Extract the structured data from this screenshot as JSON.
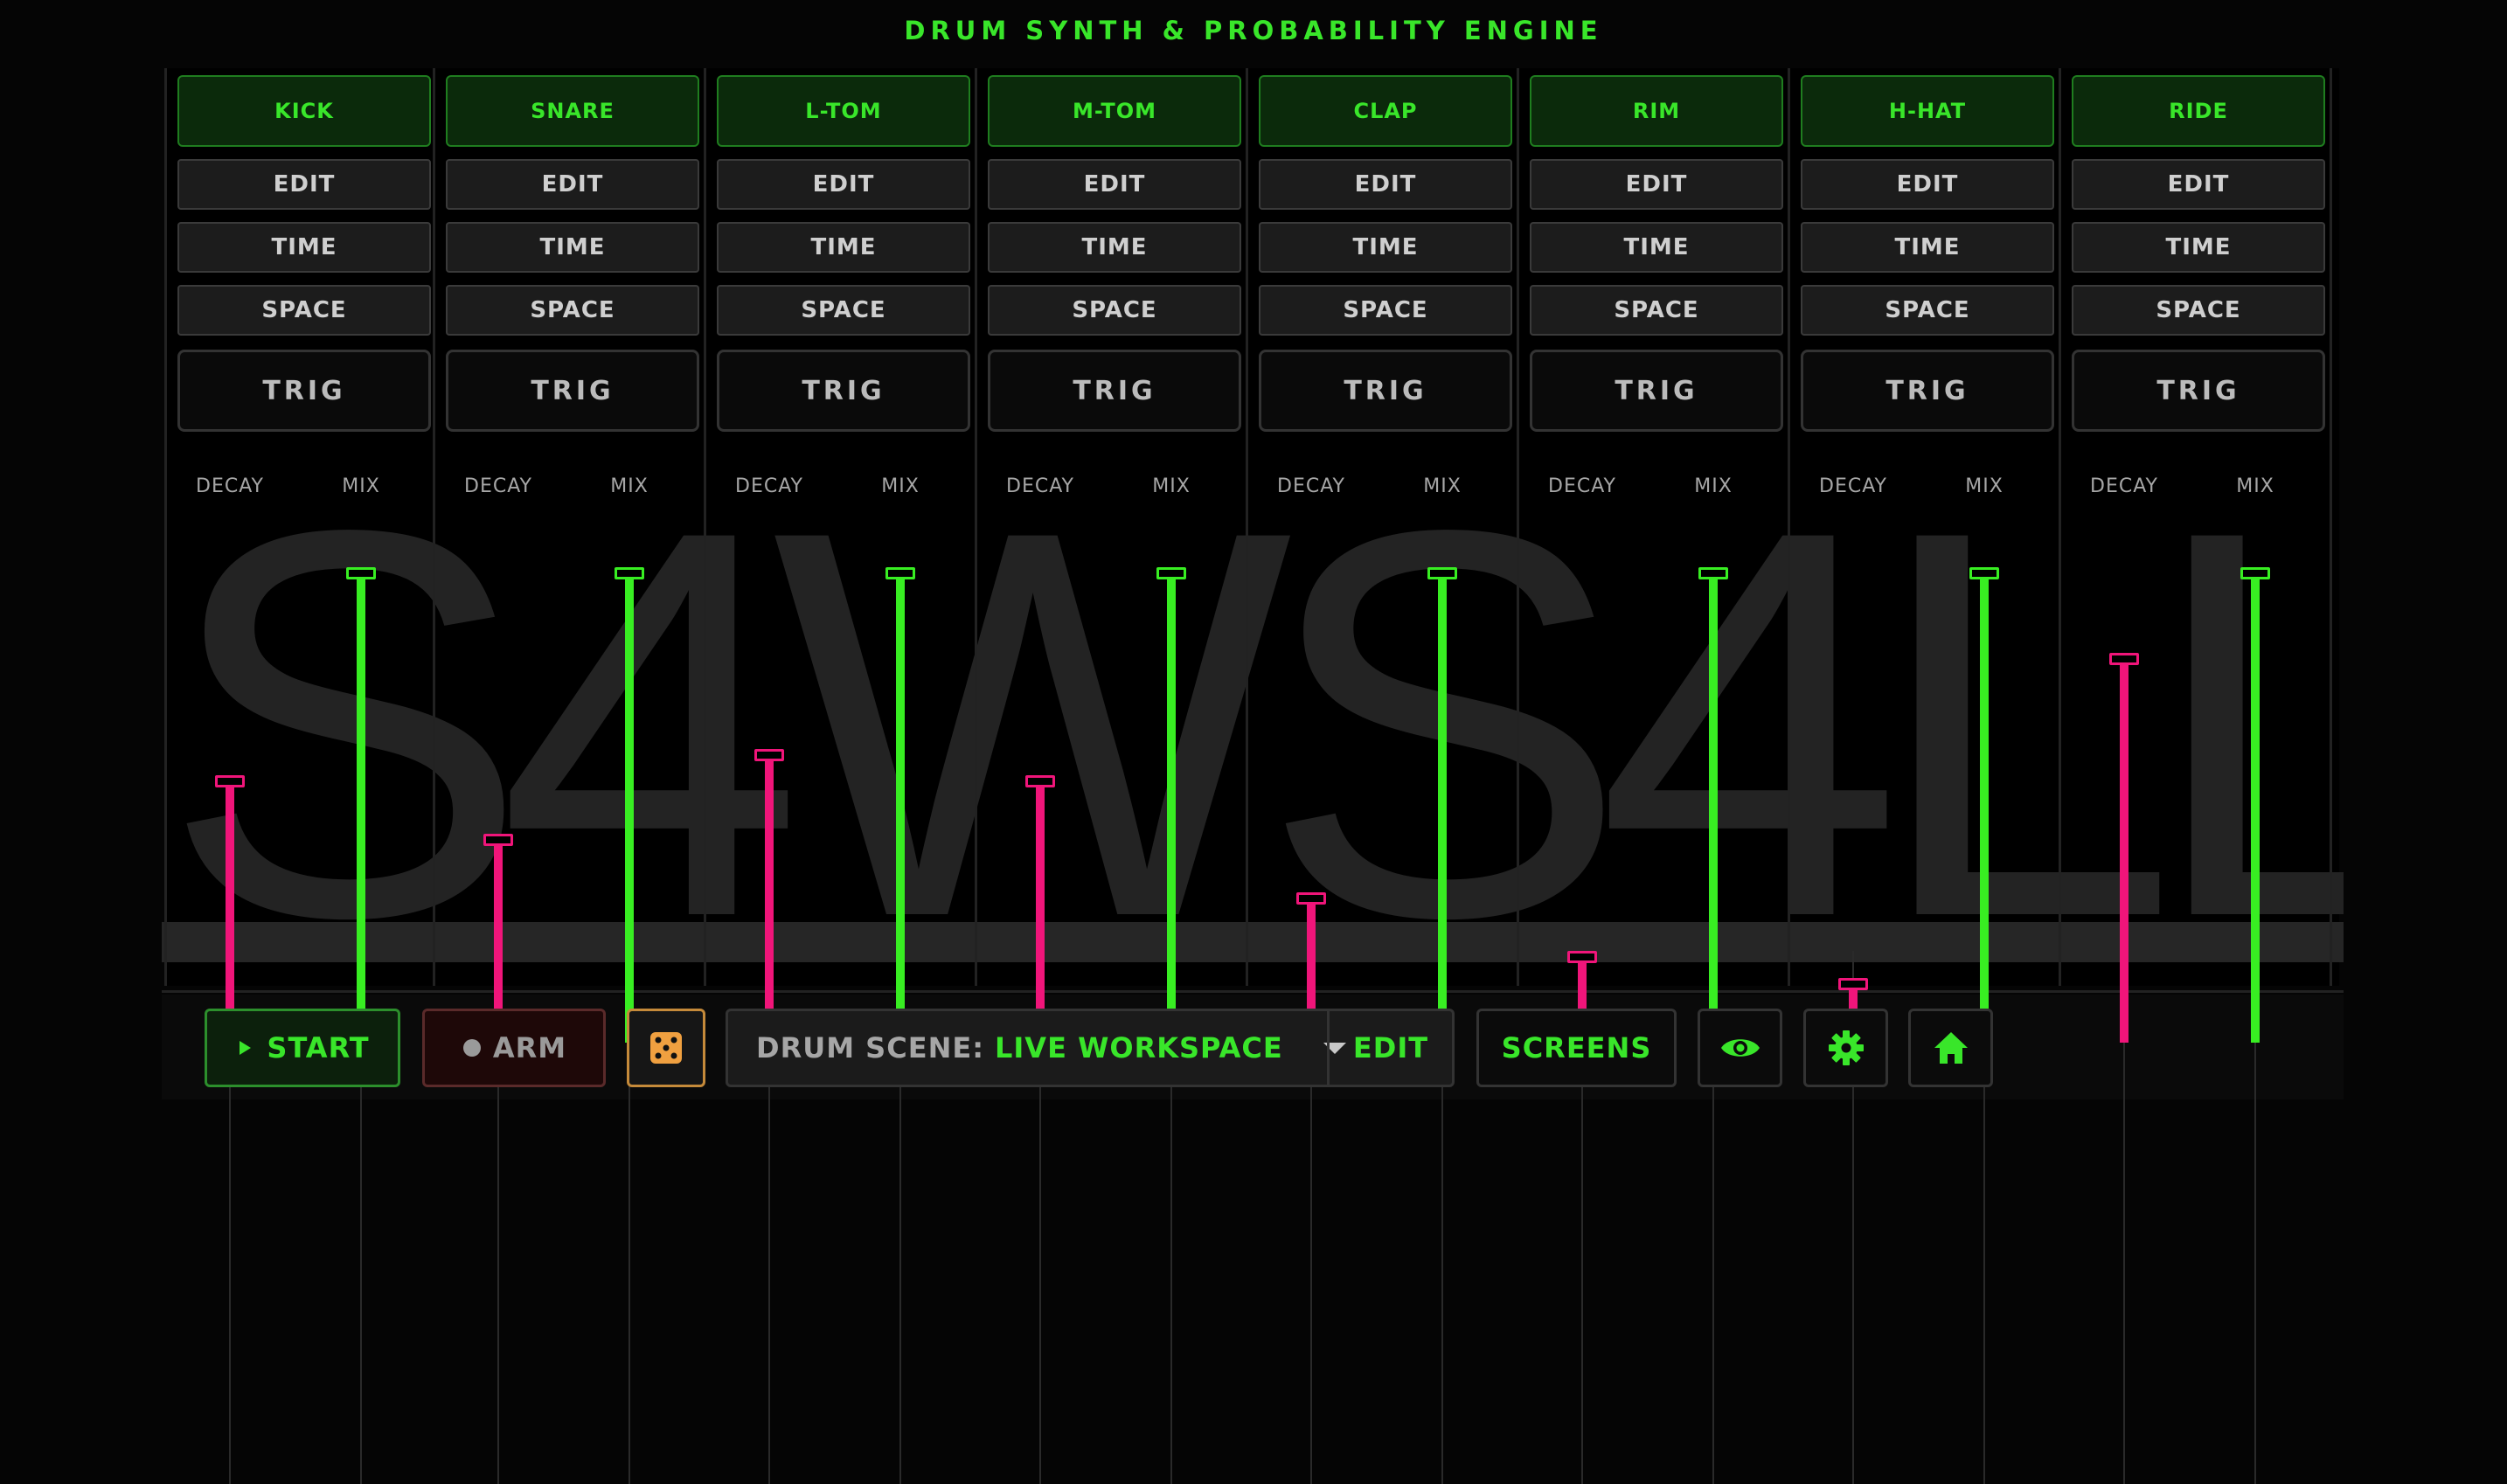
{
  "app": {
    "title": "DRUM SYNTH & PROBABILITY ENGINE"
  },
  "watermark": {
    "text": "S4WS4LL"
  },
  "labels": {
    "edit": "EDIT",
    "time": "TIME",
    "space": "SPACE",
    "trig": "TRIG",
    "decay": "DECAY",
    "mix": "MIX"
  },
  "channels": [
    {
      "name": "KICK",
      "decay": 0.49,
      "mix": 0.88
    },
    {
      "name": "SNARE",
      "decay": 0.38,
      "mix": 0.88
    },
    {
      "name": "L-TOM",
      "decay": 0.54,
      "mix": 0.88
    },
    {
      "name": "M-TOM",
      "decay": 0.49,
      "mix": 0.88
    },
    {
      "name": "CLAP",
      "decay": 0.27,
      "mix": 0.88
    },
    {
      "name": "RIM",
      "decay": 0.16,
      "mix": 0.88
    },
    {
      "name": "H-HAT",
      "decay": 0.11,
      "mix": 0.88
    },
    {
      "name": "RIDE",
      "decay": 0.72,
      "mix": 0.88
    }
  ],
  "footer": {
    "start_label": "START",
    "arm_label": "ARM",
    "scene_prefix": "DRUM SCENE:",
    "scene_value": "LIVE WORKSPACE",
    "scene_edit_label": "EDIT",
    "screens_label": "SCREENS"
  },
  "colors": {
    "accent": "#39e62a",
    "decay": "#f0157a",
    "mix": "#38ee22",
    "dice": "#f0a040"
  },
  "icons": {
    "start": "play-icon",
    "arm": "record-dot-icon",
    "dice": "dice-icon",
    "dropdown": "chevron-down-icon",
    "view": "eye-icon",
    "settings": "gear-icon",
    "home": "home-icon"
  }
}
